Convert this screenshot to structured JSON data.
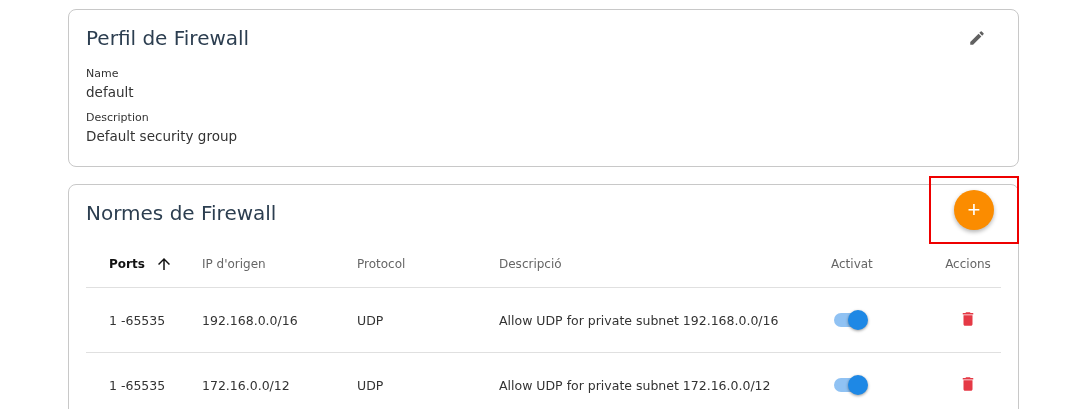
{
  "profile": {
    "title": "Perfil de Firewall",
    "fields": [
      {
        "label": "Name",
        "value": "default"
      },
      {
        "label": "Description",
        "value": "Default security group"
      }
    ]
  },
  "rules": {
    "title": "Normes de Firewall",
    "add_button": {
      "label": "+",
      "highlighted": true
    },
    "columns": [
      {
        "label": "Ports",
        "sorted": true
      },
      {
        "label": "IP d'origen",
        "sorted": false
      },
      {
        "label": "Protocol",
        "sorted": false
      },
      {
        "label": "Descripció",
        "sorted": false
      },
      {
        "label": "Activat",
        "sorted": false
      },
      {
        "label": "Accions",
        "sorted": false
      }
    ],
    "rows": [
      {
        "ports": "1 -65535",
        "ip": "192.168.0.0/16",
        "protocol": "UDP",
        "description": "Allow UDP for private subnet 192.168.0.0/16",
        "enabled": true
      },
      {
        "ports": "1 -65535",
        "ip": "172.16.0.0/12",
        "protocol": "UDP",
        "description": "Allow UDP for private subnet 172.16.0.0/12",
        "enabled": true
      }
    ]
  }
}
